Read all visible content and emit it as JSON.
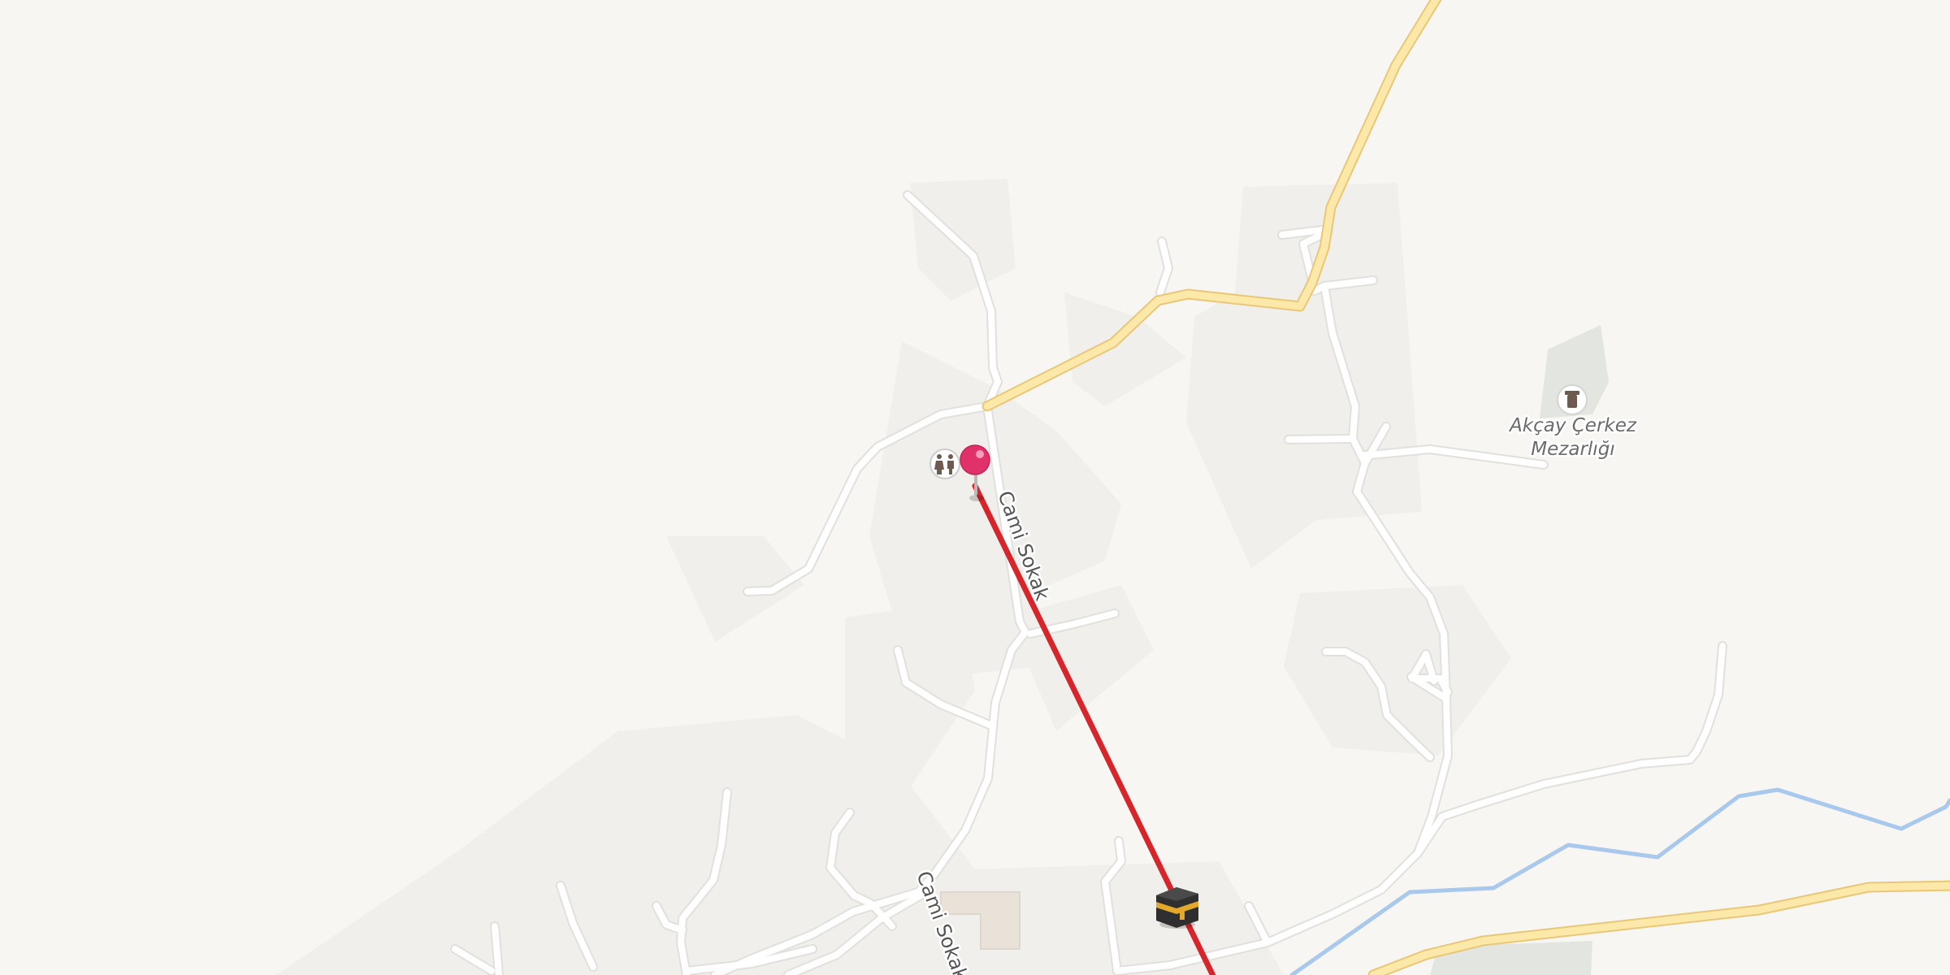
{
  "map": {
    "colors": {
      "background": "#f8f6f3",
      "residential": "#f0eeeb",
      "minor_road": "#ffffff",
      "main_road": "#fce8a8",
      "stream": "#a8c8ec",
      "route_line": "#d7262b",
      "pin": "#e0316a",
      "cemetery_area": "#e2e5e0"
    },
    "labels": {
      "road_upper": "Cami Sokak",
      "road_lower": "Cami Sokak",
      "cemetery_line1": "Akçay Çerkez",
      "cemetery_line2": "Mezarlığı"
    },
    "markers": {
      "pin": "location-pin-icon",
      "toilets": "toilets-icon",
      "cemetery": "cemetery-icon",
      "destination": "kaaba-icon"
    }
  }
}
